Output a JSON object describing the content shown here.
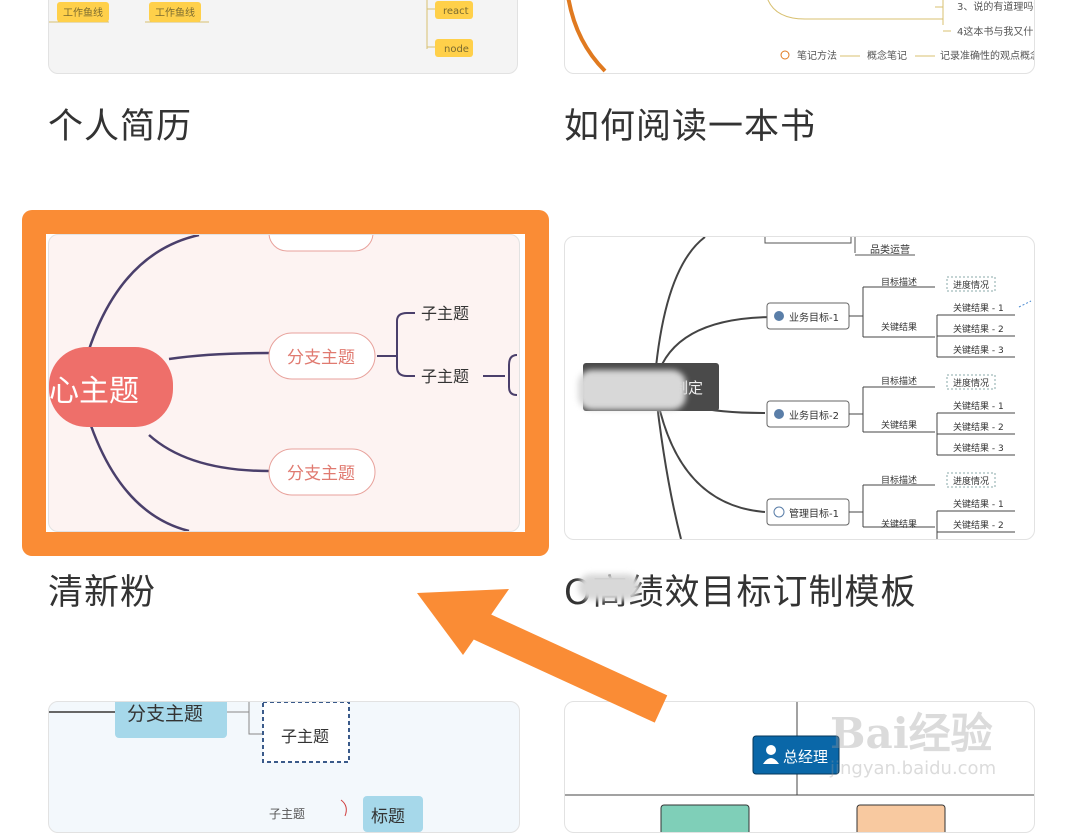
{
  "templates": [
    {
      "title": "个人简历",
      "preview": {
        "tags": [
          "工作鱼线",
          "工作鱼线",
          "react",
          "node"
        ]
      }
    },
    {
      "title": "如何阅读一本书",
      "preview": {
        "lines": [
          "3、说的有道理吗？",
          "4这本书与我又什么"
        ],
        "bottom": [
          "笔记方法",
          "概念笔记",
          "记录准确性的观点概念"
        ]
      }
    },
    {
      "title": "清新粉",
      "preview": {
        "center": "心主题",
        "branches": [
          "分支主题",
          "分支主题"
        ],
        "subs": [
          "子主题",
          "子主题"
        ]
      }
    },
    {
      "title": "O高绩效目标订制模板",
      "preview": {
        "center": "制定",
        "top": "品类运营",
        "goals": [
          "业务目标-1",
          "业务目标-2",
          "管理目标-1"
        ],
        "labels": [
          "目标描述",
          "关键结果",
          "进度情况"
        ],
        "results": [
          "关键结果 - 1",
          "关键结果 - 2",
          "关键结果 - 3"
        ]
      }
    },
    {
      "title": "",
      "preview": {
        "branch": "分支主题",
        "sub": "子主题",
        "sub2": "子主题",
        "tag": "标题"
      }
    },
    {
      "title": "",
      "preview": {
        "manager": "总经理"
      }
    }
  ],
  "watermark": {
    "main": "Bai经验",
    "sub": "jingyan.baidu.com"
  },
  "colors": {
    "highlight": "#fa8c35",
    "pink_center": "#ee6f6a",
    "org_blue": "#0a67a8"
  }
}
